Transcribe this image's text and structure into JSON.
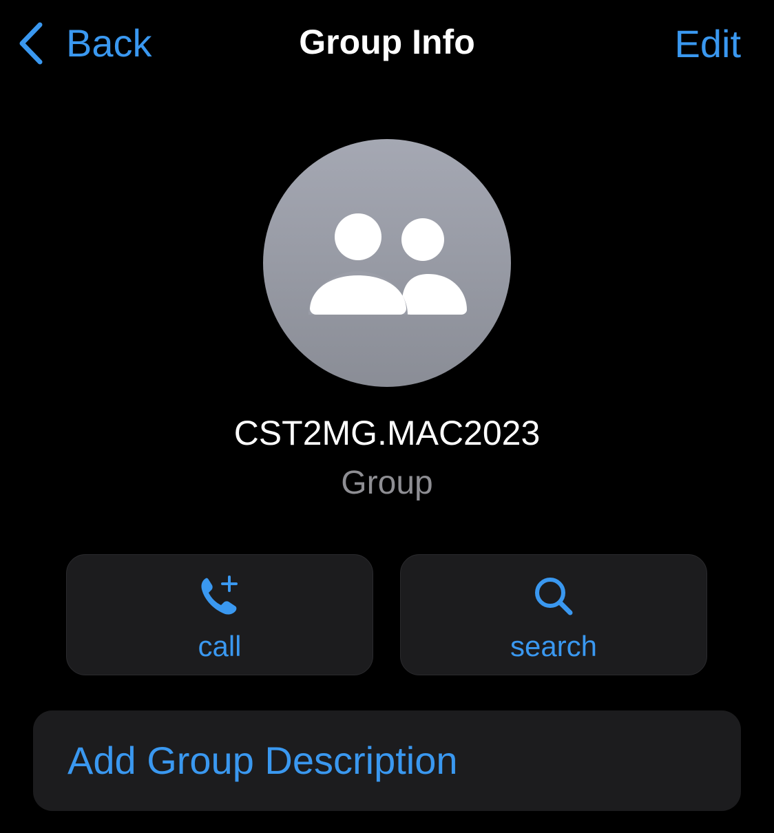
{
  "nav": {
    "back_label": "Back",
    "title": "Group Info",
    "edit_label": "Edit"
  },
  "profile": {
    "avatar_icon": "group-people-icon",
    "name": "CST2MG.MAC2023",
    "subtitle": "Group"
  },
  "actions": [
    {
      "icon": "phone-add-icon",
      "label": "call"
    },
    {
      "icon": "search-icon",
      "label": "search"
    }
  ],
  "description": {
    "label": "Add Group Description"
  },
  "colors": {
    "accent": "#3a98f0",
    "background": "#000000",
    "card": "#1c1c1e",
    "secondary_text": "#8e8e93"
  }
}
